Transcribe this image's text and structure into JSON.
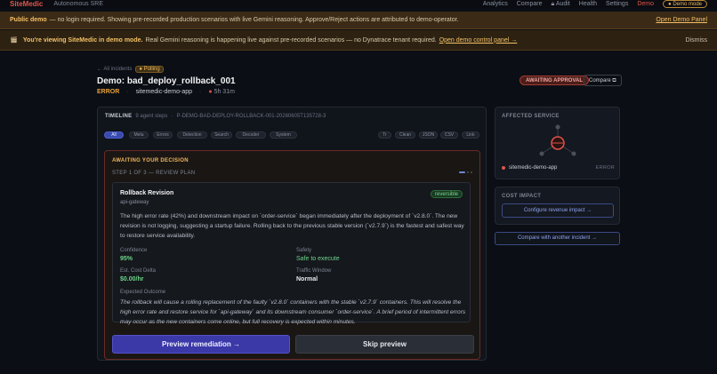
{
  "topbar": {
    "brand": "SiteMedic",
    "subtitle": "Autonomous SRE",
    "nav": [
      "Analytics",
      "Compare",
      "Audit",
      "Health",
      "Settings",
      "Demo"
    ],
    "demo_pill": "Demo mode"
  },
  "banner_public": {
    "bold": "Public demo",
    "text": "— no login required. Showing pre-recorded production scenarios with live Gemini reasoning. Approve/Reject actions are attributed to demo-operator.",
    "link": "Open Demo Panel"
  },
  "banner_demo": {
    "bold": "You're viewing SiteMedic in demo mode.",
    "text": "Real Gemini reasoning is happening live against pre-recorded scenarios — no Dynatrace tenant required.",
    "link": "Open demo control panel →",
    "dismiss": "Dismiss"
  },
  "incident": {
    "back": "← All incidents",
    "polling": "Polling",
    "title": "Demo: bad_deploy_rollback_001",
    "severity": "ERROR",
    "service": "sitemedic-demo-app",
    "age": "5h 31m",
    "status_badge": "AWAITING APPROVAL",
    "compare": "Compare"
  },
  "timeline": {
    "label": "TIMELINE",
    "steps": "9 agent steps",
    "run_id": "P-DEMO-BAD-DEPLOY-ROLLBACK-001-20260605T135728-3",
    "filters": [
      "All",
      "Meta",
      "Errors",
      "Detection",
      "Search",
      "Decoder",
      "System"
    ],
    "tools": [
      "Tr",
      "Clean",
      "JSON",
      "CSV",
      "Link"
    ]
  },
  "decision": {
    "label": "AWAITING YOUR DECISION",
    "step": "STEP 1 OF 3 — REVIEW PLAN",
    "plan_title": "Rollback Revision",
    "plan_sub": "api-gateway",
    "plan_badge": "reversible",
    "description": "The high error rate (42%) and downstream impact on `order-service` began immediately after the deployment of `v2.8.0`. The new revision is not logging, suggesting a startup failure. Rolling back to the previous stable version (`v2.7.9`) is the fastest and safest way to restore service availability.",
    "confidence_label": "Confidence",
    "confidence": "95%",
    "safety_label": "Safety",
    "safety": "Safe to execute",
    "cost_label": "Est. Cost Delta",
    "cost": "$0.00/hr",
    "window_label": "Traffic Window",
    "window": "Normal",
    "outcome_label": "Expected Outcome",
    "outcome": "The rollback will cause a rolling replacement of the faulty `v2.8.0` containers with the stable `v2.7.9` containers. This will resolve the high error rate and restore service for `api-gateway` and its downstream consumer `order-service`. A brief period of intermittent errors may occur as the new containers come online, but full recovery is expected within minutes.",
    "primary": "Preview remediation →",
    "secondary": "Skip preview"
  },
  "affected": {
    "label": "AFFECTED SERVICE",
    "service": "sitemedic-demo-app",
    "status": "ERROR"
  },
  "cost_impact": {
    "label": "COST IMPACT",
    "button": "Configure revenue impact →"
  },
  "compare_other": "Compare with another incident →",
  "colors": {
    "accent_red": "#e0544a",
    "warning_amber": "#f0b75a",
    "primary_button": "#3b38a8",
    "success_green": "#6ed48a"
  }
}
